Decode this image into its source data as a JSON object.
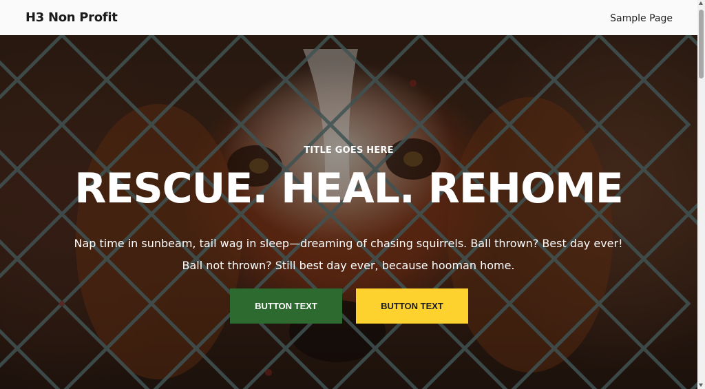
{
  "header": {
    "site_title": "H3 Non Profit",
    "nav_items": [
      "Sample Page"
    ]
  },
  "hero": {
    "eyebrow": "TITLE GOES HERE",
    "headline": "RESCUE. HEAL. REHOME",
    "lead": "Nap time in sunbeam, tail wag in sleep—dreaming of chasing squirrels. Ball thrown? Best day ever! Ball not thrown? Still best day ever, because hooman home.",
    "primary_button": "BUTTON TEXT",
    "secondary_button": "BUTTON TEXT"
  },
  "colors": {
    "primary_button_bg": "#2d6a2f",
    "secondary_button_bg": "#fdd22e",
    "header_bg": "#fafafa",
    "text_on_hero": "#ffffff"
  },
  "icons": [
    "scroll-up-arrow-icon",
    "scroll-down-arrow-icon"
  ]
}
